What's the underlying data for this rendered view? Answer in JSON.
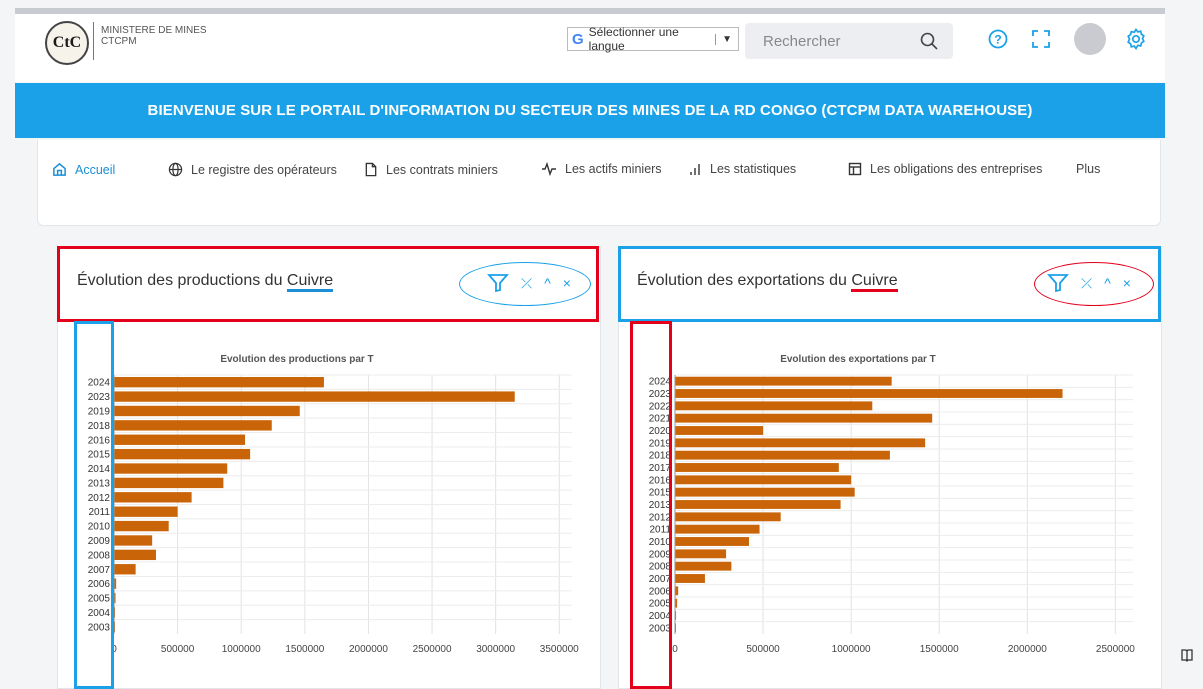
{
  "header": {
    "logo_text": "CtC",
    "org_line1": "MINISTERE DE MINES",
    "org_line2": "CTCPM",
    "language_label": "Sélectionner une langue",
    "language_arrow": "▼",
    "search_placeholder": "Rechercher",
    "icons": [
      "search-icon",
      "help-icon",
      "fullscreen-icon",
      "avatar",
      "gear-icon"
    ]
  },
  "banner": {
    "title": "BIENVENUE SUR LE PORTAIL D'INFORMATION DU SECTEUR DES MINES DE LA RD CONGO (CTCPM DATA WAREHOUSE)"
  },
  "nav": {
    "items": [
      {
        "label": "Accueil",
        "icon": "home-icon"
      },
      {
        "label": "Le registre des opérateurs",
        "icon": "globe-icon"
      },
      {
        "label": "Les contrats miniers",
        "icon": "document-icon"
      },
      {
        "label": "Les actifs miniers",
        "icon": "activity-icon"
      },
      {
        "label": "Les statistiques",
        "icon": "bar-chart-icon"
      },
      {
        "label": "Les obligations des entreprises",
        "icon": "table-icon"
      },
      {
        "label": "Plus",
        "icon": ""
      }
    ]
  },
  "panels": {
    "production": {
      "title_prefix": "Évolution des productions du ",
      "title_mineral": "Cuivre"
    },
    "exports": {
      "title_prefix": "Évolution des exportations du ",
      "title_mineral": "Cuivre"
    }
  },
  "colors": {
    "accent": "#1aa1e8",
    "bar": "#c96508",
    "highlight_red": "#e3001b"
  },
  "chart_data": [
    {
      "type": "bar",
      "orientation": "horizontal",
      "title": "Evolution des productions par T",
      "xlabel": "",
      "ylabel": "",
      "categories": [
        "2024",
        "2023",
        "2019",
        "2018",
        "2016",
        "2015",
        "2014",
        "2013",
        "2012",
        "2011",
        "2010",
        "2009",
        "2008",
        "2007",
        "2006",
        "2005",
        "2004",
        "2003"
      ],
      "values": [
        1650000,
        3150000,
        1460000,
        1240000,
        1030000,
        1070000,
        890000,
        860000,
        610000,
        500000,
        430000,
        300000,
        330000,
        170000,
        17000,
        12000,
        8000,
        6000
      ],
      "xlim": [
        0,
        3600000
      ],
      "xticks": [
        "0",
        "500000",
        "1000000",
        "1500000",
        "2000000",
        "2500000",
        "3000000",
        "3500000"
      ],
      "grid": true
    },
    {
      "type": "bar",
      "orientation": "horizontal",
      "title": "Evolution des exportations par T",
      "xlabel": "",
      "ylabel": "",
      "categories": [
        "2024",
        "2023",
        "2022",
        "2021",
        "2020",
        "2019",
        "2018",
        "2017",
        "2016",
        "2015",
        "2013",
        "2012",
        "2011",
        "2010",
        "2009",
        "2008",
        "2007",
        "2006",
        "2005",
        "2004",
        "2003"
      ],
      "values": [
        1230000,
        2200000,
        1120000,
        1460000,
        500000,
        1420000,
        1220000,
        930000,
        1000000,
        1020000,
        940000,
        600000,
        480000,
        420000,
        290000,
        320000,
        170000,
        18000,
        12000,
        6000,
        4000
      ],
      "xlim": [
        0,
        2600000
      ],
      "xticks": [
        "0",
        "500000",
        "1000000",
        "1500000",
        "2000000",
        "2500000"
      ],
      "grid": true
    }
  ]
}
